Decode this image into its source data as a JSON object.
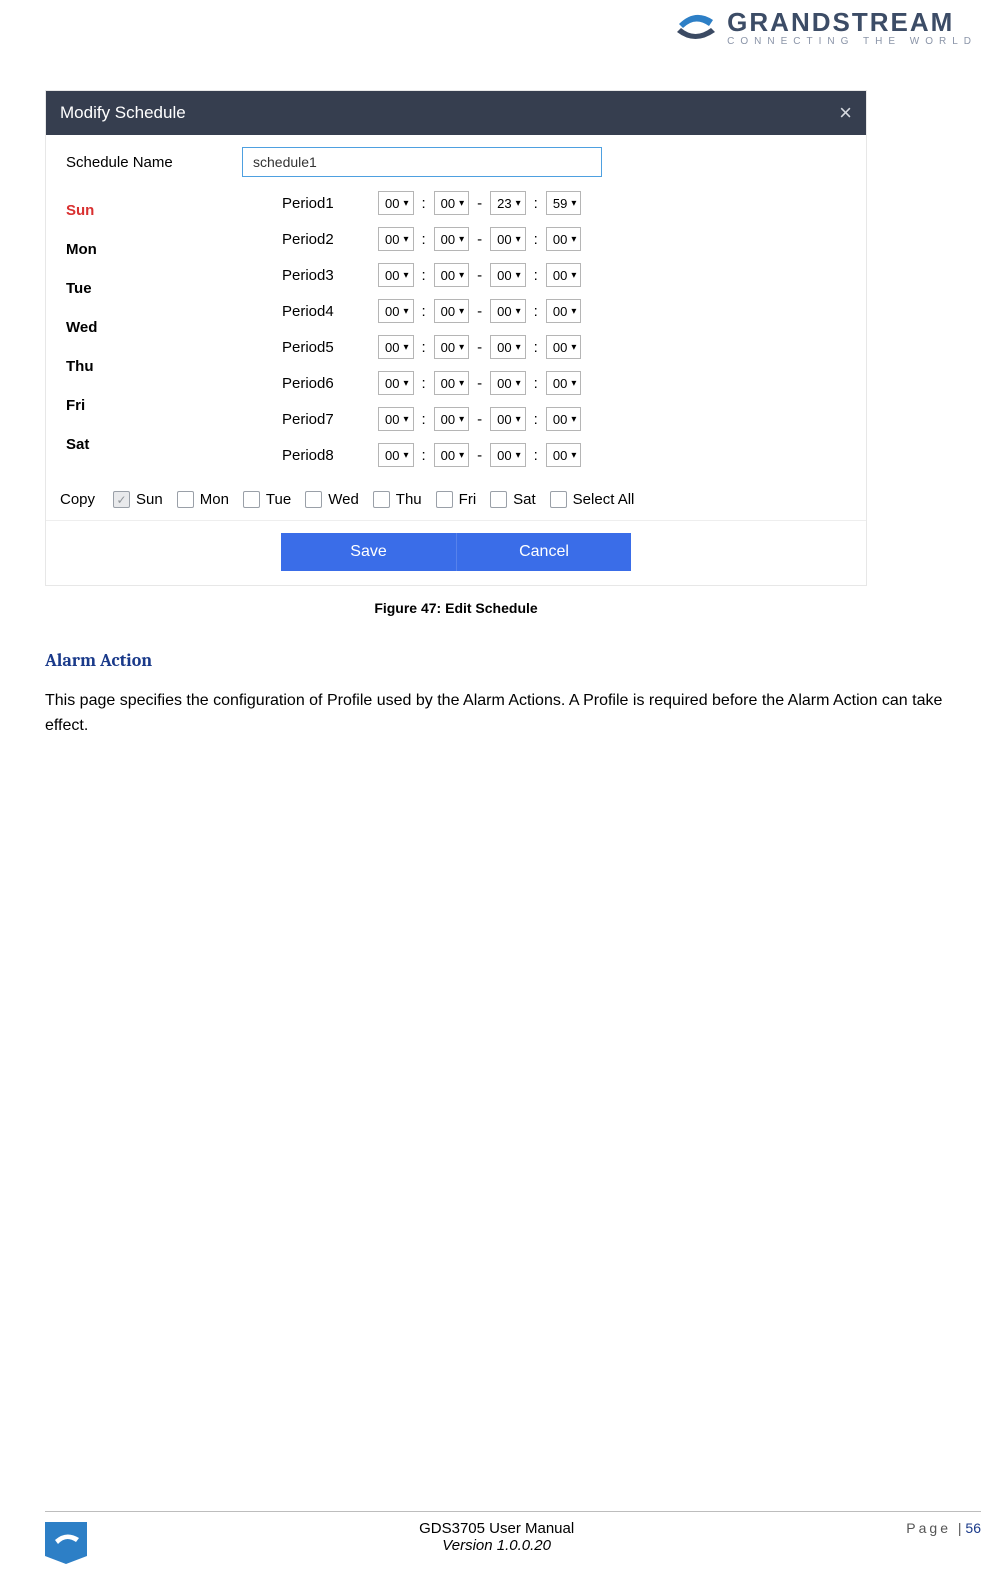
{
  "brand": {
    "name": "GRANDSTREAM",
    "tagline": "CONNECTING THE WORLD"
  },
  "dialog": {
    "title": "Modify Schedule",
    "schedule_name_label": "Schedule Name",
    "schedule_name_value": "schedule1",
    "days": [
      "Sun",
      "Mon",
      "Tue",
      "Wed",
      "Thu",
      "Fri",
      "Sat"
    ],
    "periods": [
      {
        "label": "Period1",
        "h1": "00",
        "m1": "00",
        "h2": "23",
        "m2": "59"
      },
      {
        "label": "Period2",
        "h1": "00",
        "m1": "00",
        "h2": "00",
        "m2": "00"
      },
      {
        "label": "Period3",
        "h1": "00",
        "m1": "00",
        "h2": "00",
        "m2": "00"
      },
      {
        "label": "Period4",
        "h1": "00",
        "m1": "00",
        "h2": "00",
        "m2": "00"
      },
      {
        "label": "Period5",
        "h1": "00",
        "m1": "00",
        "h2": "00",
        "m2": "00"
      },
      {
        "label": "Period6",
        "h1": "00",
        "m1": "00",
        "h2": "00",
        "m2": "00"
      },
      {
        "label": "Period7",
        "h1": "00",
        "m1": "00",
        "h2": "00",
        "m2": "00"
      },
      {
        "label": "Period8",
        "h1": "00",
        "m1": "00",
        "h2": "00",
        "m2": "00"
      }
    ],
    "copy_label": "Copy",
    "copy_days": [
      {
        "label": "Sun",
        "checked": true
      },
      {
        "label": "Mon",
        "checked": false
      },
      {
        "label": "Tue",
        "checked": false
      },
      {
        "label": "Wed",
        "checked": false
      },
      {
        "label": "Thu",
        "checked": false
      },
      {
        "label": "Fri",
        "checked": false
      },
      {
        "label": "Sat",
        "checked": false
      },
      {
        "label": "Select All",
        "checked": false
      }
    ],
    "save_label": "Save",
    "cancel_label": "Cancel"
  },
  "caption": "Figure 47: Edit Schedule",
  "section": {
    "heading": "Alarm Action",
    "body": "This page specifies the configuration of Profile used by the Alarm Actions. A Profile is required before the Alarm Action can take effect."
  },
  "footer": {
    "manual": "GDS3705 User Manual",
    "version": "Version 1.0.0.20",
    "page_label": "Page",
    "page_num": "56"
  }
}
